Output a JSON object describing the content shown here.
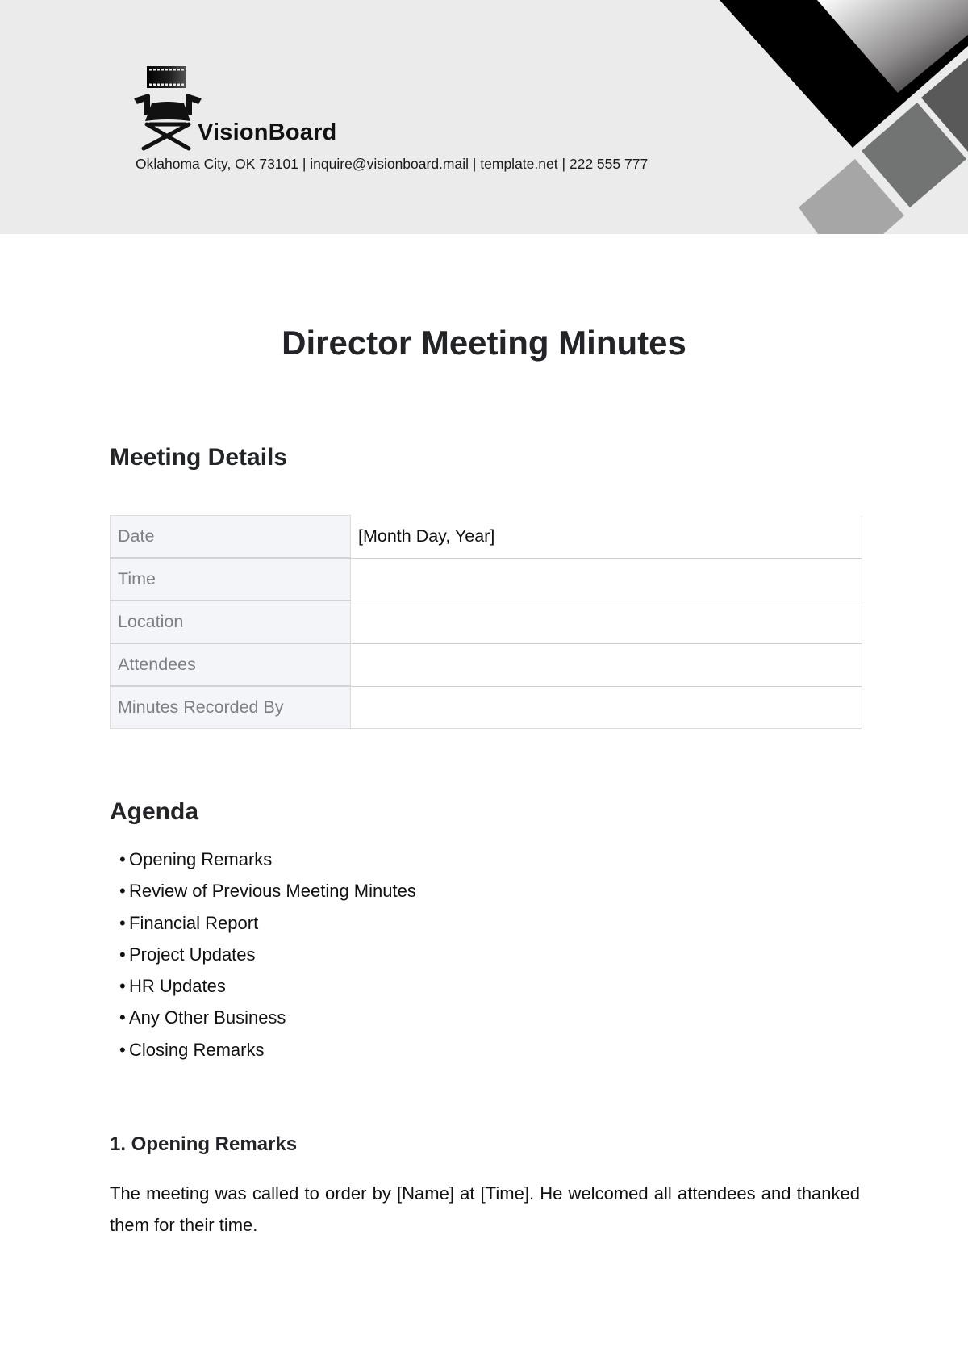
{
  "header": {
    "brand_name": "VisionBoard",
    "contact_line": "Oklahoma City, OK 73101 | inquire@visionboard.mail | template.net | 222 555 777",
    "logo_icon": "directors-chair-film-icon",
    "colors": {
      "background": "#ebebeb",
      "band_black": "#000000",
      "diamond_dark": "#595959",
      "diamond_mid": "#727473",
      "diamond_light": "#a6a6a6"
    }
  },
  "document": {
    "title": "Director Meeting Minutes"
  },
  "meeting_details": {
    "heading": "Meeting Details",
    "rows": [
      {
        "label": "Date",
        "value": "[Month Day, Year]"
      },
      {
        "label": "Time",
        "value": ""
      },
      {
        "label": "Location",
        "value": ""
      },
      {
        "label": "Attendees",
        "value": ""
      },
      {
        "label": "Minutes Recorded By",
        "value": ""
      }
    ]
  },
  "agenda": {
    "heading": "Agenda",
    "bullet": "•",
    "items": [
      "Opening Remarks",
      "Review of Previous Meeting Minutes",
      "Financial Report",
      "Project Updates",
      "HR Updates",
      "Any Other Business",
      "Closing Remarks"
    ]
  },
  "sections": [
    {
      "heading": "1. Opening Remarks",
      "body": "The meeting was called to order by [Name] at [Time]. He welcomed all attendees and thanked them for their time."
    }
  ]
}
